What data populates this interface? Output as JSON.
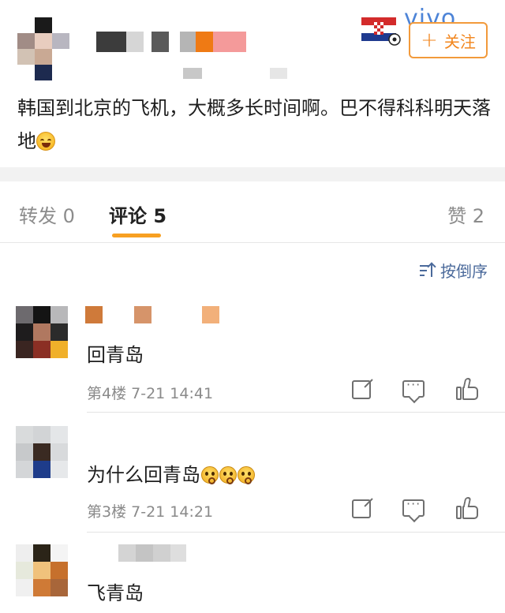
{
  "post": {
    "brand_mark": "vivo",
    "follow_label": "关注",
    "follow_plus": "+",
    "text": "韩国到北京的飞机，大概多长时间啊。巴不得科科明天落地",
    "emoji_icon": "laughing-tears-emoji"
  },
  "tabs": {
    "repost_label": "转发 0",
    "comment_label": "评论 5",
    "like_label": "赞 2",
    "active_color": "#f7a022"
  },
  "sort_label": "按倒序",
  "comments": [
    {
      "text": "回青岛",
      "floor": "第4楼",
      "time": "7-21 14:41"
    },
    {
      "text": "为什么回青岛",
      "floor": "第3楼",
      "time": "7-21 14:21",
      "emoji_icon": "thinking-emoji"
    },
    {
      "text": "飞青岛"
    }
  ],
  "colors": {
    "follow_accent": "#f2861d",
    "sort_link": "#4b6a9b"
  }
}
